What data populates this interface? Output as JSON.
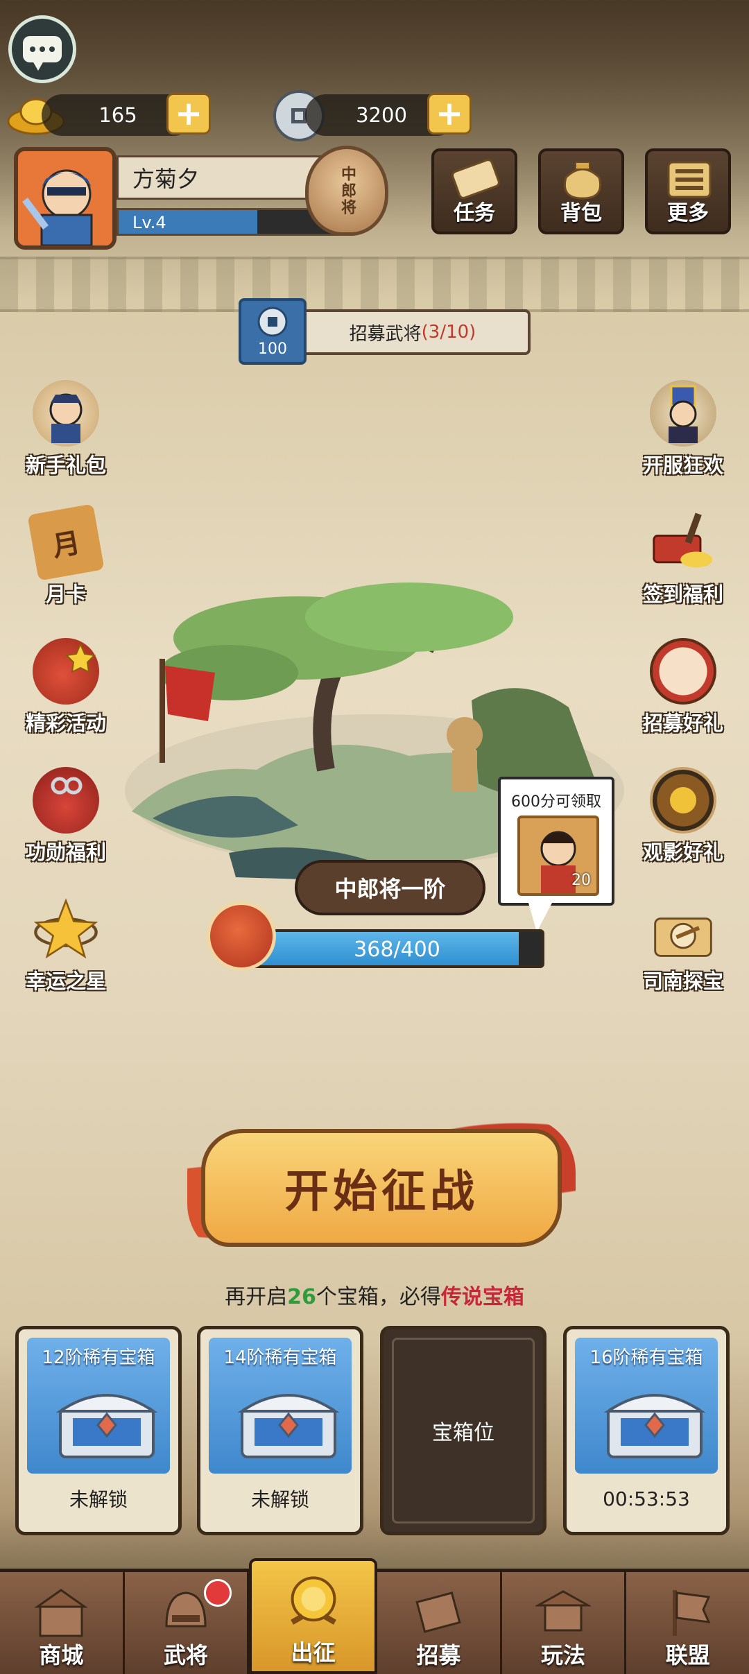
{
  "resources": {
    "gold": "165",
    "coins": "3200"
  },
  "player": {
    "name": "方菊夕",
    "level": "Lv.4",
    "level_progress": 0.6,
    "rank_badge": "中郎将"
  },
  "top_buttons": [
    {
      "label": "任务",
      "icon": "scroll-icon"
    },
    {
      "label": "背包",
      "icon": "bag-icon"
    },
    {
      "label": "更多",
      "icon": "menu-icon"
    }
  ],
  "recruit": {
    "cost": "100",
    "label": "招募武将",
    "progress": "(3/10)"
  },
  "left_side": [
    {
      "label": "新手礼包",
      "icon": "newbie-gift-icon"
    },
    {
      "label": "月卡",
      "icon": "month-card-icon",
      "glyph": "月"
    },
    {
      "label": "精彩活动",
      "icon": "event-bag-icon"
    },
    {
      "label": "功勋福利",
      "icon": "merit-bag-icon"
    },
    {
      "label": "幸运之星",
      "icon": "star-icon"
    }
  ],
  "right_side": [
    {
      "label": "开服狂欢",
      "icon": "server-carnival-icon"
    },
    {
      "label": "签到福利",
      "icon": "signin-icon"
    },
    {
      "label": "招募好礼",
      "icon": "drum-icon"
    },
    {
      "label": "观影好礼",
      "icon": "video-gift-icon"
    },
    {
      "label": "司南探宝",
      "icon": "compass-icon"
    }
  ],
  "stage": {
    "name": "中郎将一阶",
    "progress_text": "368/400",
    "progress": 0.92
  },
  "reward": {
    "title": "600分可领取",
    "count": "20"
  },
  "start_button": "开始征战",
  "chest_hint": {
    "pre": "再开启",
    "num": "26",
    "mid": "个宝箱，必得",
    "highlight": "传说宝箱"
  },
  "chests": [
    {
      "title": "12阶稀有宝箱",
      "status": "未解锁"
    },
    {
      "title": "14阶稀有宝箱",
      "status": "未解锁"
    },
    {
      "slot": "宝箱位"
    },
    {
      "title": "16阶稀有宝箱",
      "status": "00:53:53"
    }
  ],
  "nav": [
    {
      "label": "商城"
    },
    {
      "label": "武将"
    },
    {
      "label": "出征"
    },
    {
      "label": "招募"
    },
    {
      "label": "玩法"
    },
    {
      "label": "联盟"
    }
  ]
}
